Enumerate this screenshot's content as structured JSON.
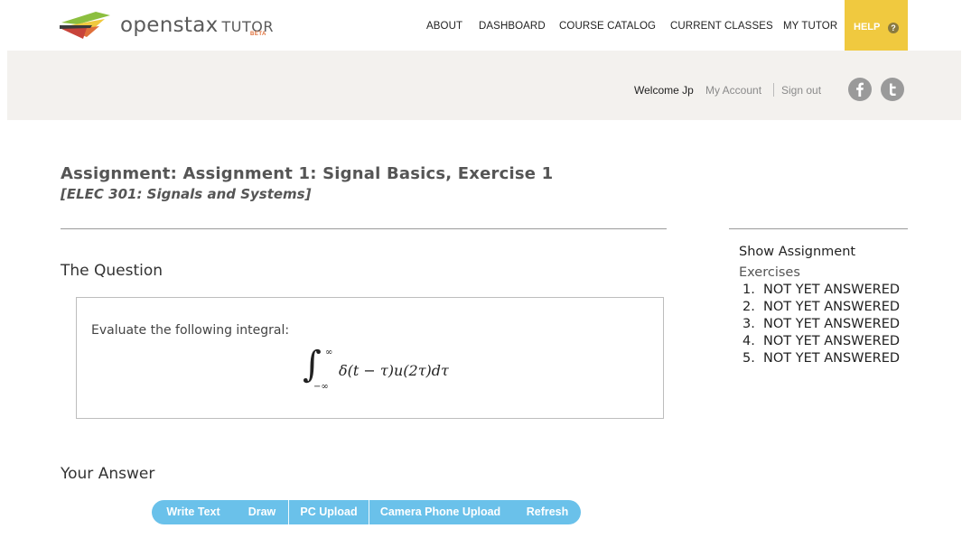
{
  "brand": {
    "name": "openstax",
    "product": "TUTOR",
    "badge": "BETA",
    "colors": {
      "orange": "#e0703a",
      "red": "#c8443a",
      "yellow": "#f0c93f",
      "green": "#8cbf3f",
      "dark": "#3b3b3b"
    }
  },
  "nav": {
    "items": [
      "ABOUT",
      "DASHBOARD",
      "COURSE CATALOG",
      "CURRENT CLASSES",
      "MY TUTOR"
    ],
    "help_label": "HELP",
    "help_icon": "?",
    "help_color": "#f0c93f"
  },
  "account": {
    "welcome": "Welcome Jp",
    "my_account": "My Account",
    "sign_out": "Sign out",
    "social": [
      "facebook-icon",
      "twitter-icon"
    ]
  },
  "assignment": {
    "title": "Assignment: Assignment 1: Signal Basics, Exercise 1",
    "course": "[ELEC 301: Signals and Systems]"
  },
  "question": {
    "heading": "The Question",
    "prompt": "Evaluate the following integral:",
    "math": {
      "upper": "∞",
      "lower": "−∞",
      "integrand": "δ(t − τ)u(2τ)dτ"
    }
  },
  "answer": {
    "heading": "Your Answer",
    "buttons": [
      "Write Text",
      "Draw",
      "PC Upload",
      "Camera Phone Upload",
      "Refresh"
    ],
    "button_color": "#6ac1ea"
  },
  "sidebar": {
    "show_assignment": "Show Assignment",
    "exercises_label": "Exercises",
    "exercises": [
      {
        "num": "1.",
        "status": "NOT YET ANSWERED"
      },
      {
        "num": "2.",
        "status": "NOT YET ANSWERED"
      },
      {
        "num": "3.",
        "status": "NOT YET ANSWERED"
      },
      {
        "num": "4.",
        "status": "NOT YET ANSWERED"
      },
      {
        "num": "5.",
        "status": "NOT YET ANSWERED"
      }
    ]
  }
}
